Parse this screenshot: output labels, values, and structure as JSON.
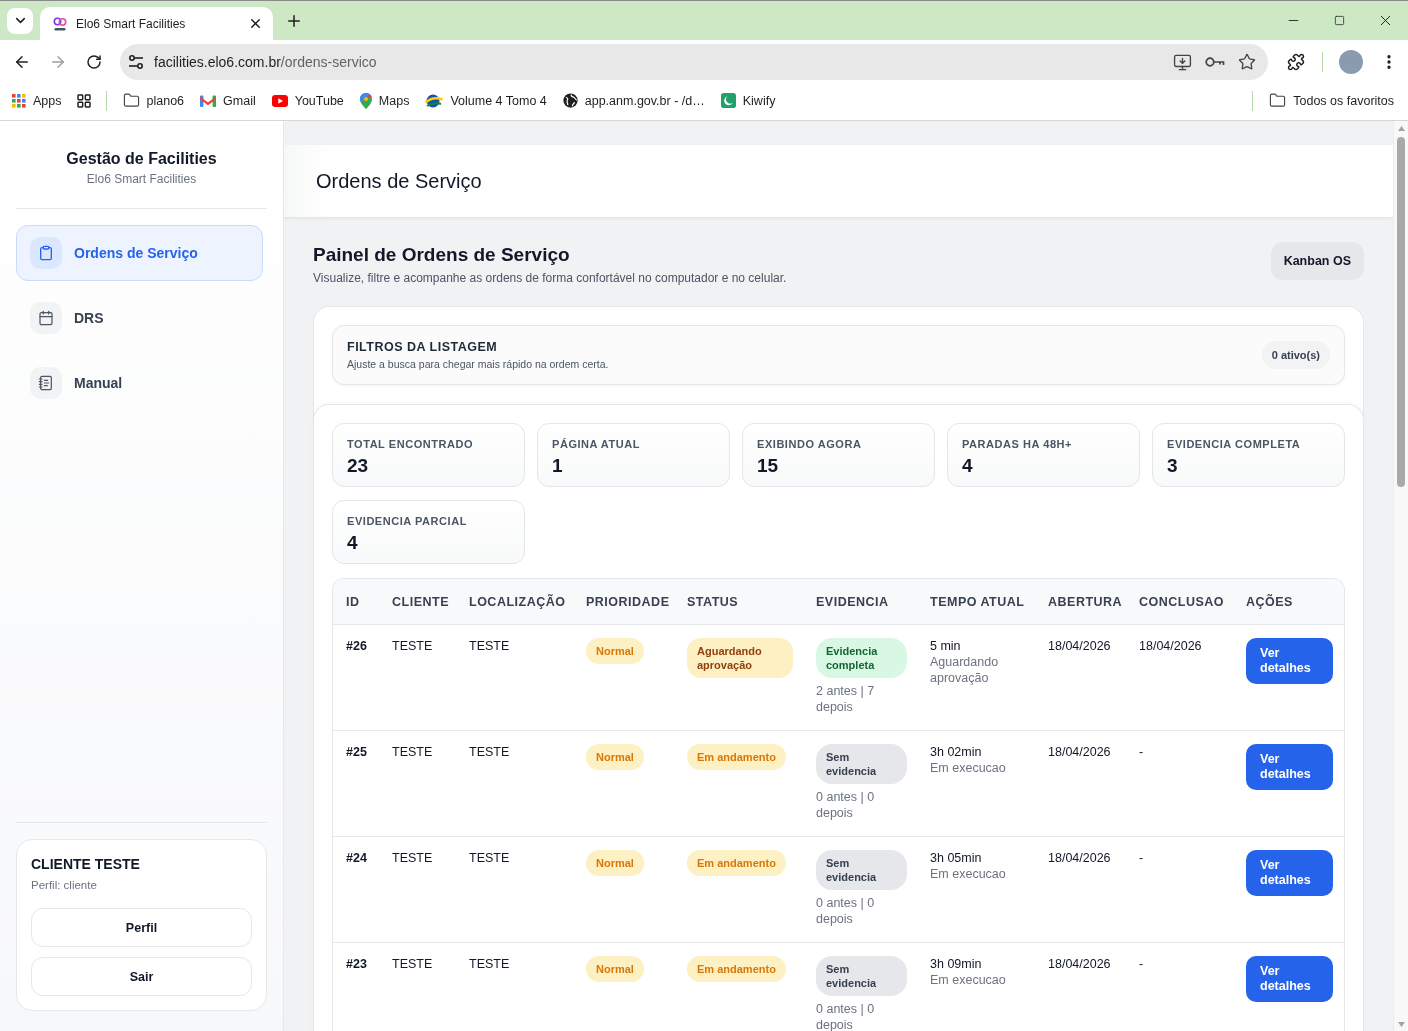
{
  "browser": {
    "tabs": [
      {
        "title": "Elo6 Smart Facilities",
        "selected": true
      }
    ],
    "address": {
      "host": "facilities.elo6.com.br",
      "path": "/ordens-servico"
    },
    "apps": {
      "label": "Apps"
    },
    "bookmarks": [
      {
        "kind": "folder",
        "label": "plano6"
      },
      {
        "kind": "mail",
        "label": "Gmail"
      },
      {
        "kind": "video",
        "label": "YouTube"
      },
      {
        "kind": "map",
        "label": "Maps"
      },
      {
        "kind": "swoosh",
        "label": "Volume 4 Tomo 4"
      },
      {
        "kind": "globe",
        "label": "app.anm.gov.br - /d…"
      },
      {
        "kind": "crescent",
        "label": "Kiwify"
      }
    ],
    "all_bookmarks": "Todos os favoritos"
  },
  "sidebar": {
    "title": "Gestão de Facilities",
    "subtitle": "Elo6 Smart Facilities",
    "nav": [
      {
        "label": "Ordens de Serviço",
        "kind": "orders",
        "selected": true
      },
      {
        "label": "DRS",
        "kind": "calendar",
        "selected": false
      },
      {
        "label": "Manual",
        "kind": "manual",
        "selected": false
      }
    ],
    "user": {
      "name": "CLIENTE TESTE",
      "role": "Perfil: cliente",
      "buttons": [
        "Perfil",
        "Sair"
      ]
    }
  },
  "header": {
    "title": "Ordens de Serviço"
  },
  "panel": {
    "title": "Painel de Ordens de Serviço",
    "subtitle": "Visualize, filtre e acompanhe as ordens de forma confortável no computador e no celular.",
    "button": "Kanban OS"
  },
  "filters": {
    "title": "FILTROS DA LISTAGEM",
    "hint": "Ajuste a busca para chegar mais rápido na ordem certa.",
    "active_count": "0 ativo(s)"
  },
  "stats": [
    {
      "label": "TOTAL ENCONTRADO",
      "value": "23"
    },
    {
      "label": "PÁGINA ATUAL",
      "value": "1"
    },
    {
      "label": "EXIBINDO AGORA",
      "value": "15"
    },
    {
      "label": "PARADAS HA 48H+",
      "value": "4"
    },
    {
      "label": "EVIDENCIA COMPLETA",
      "value": "3"
    },
    {
      "label": "EVIDENCIA PARCIAL",
      "value": "4"
    }
  ],
  "table": {
    "columns": [
      "ID",
      "CLIENTE",
      "LOCALIZAÇÃO",
      "PRIORIDADE",
      "STATUS",
      "EVIDENCIA",
      "TEMPO ATUAL",
      "ABERTURA",
      "CONCLUSAO",
      "AÇÕES"
    ],
    "rows": [
      {
        "id": "#26",
        "client": "TESTE",
        "location": "TESTE",
        "priority": {
          "label": "Normal",
          "kind": "normal"
        },
        "status": {
          "label": "Aguardando aprovação",
          "kind": "awaiting"
        },
        "evidence": {
          "label": "Evidencia completa",
          "kind": "complete"
        },
        "evidence_count": "2 antes | 7 depois",
        "time": "5 min",
        "time_note": "Aguardando aprovação",
        "opened": "18/04/2026",
        "closed": "18/04/2026",
        "action": "Ver detalhes"
      },
      {
        "id": "#25",
        "client": "TESTE",
        "location": "TESTE",
        "priority": {
          "label": "Normal",
          "kind": "normal"
        },
        "status": {
          "label": "Em andamento",
          "kind": "in_progress"
        },
        "evidence": {
          "label": "Sem evidencia",
          "kind": "none"
        },
        "evidence_count": "0 antes | 0 depois",
        "time": "3h 02min",
        "time_note": "Em execucao",
        "opened": "18/04/2026",
        "closed": "-",
        "action": "Ver detalhes"
      },
      {
        "id": "#24",
        "client": "TESTE",
        "location": "TESTE",
        "priority": {
          "label": "Normal",
          "kind": "normal"
        },
        "status": {
          "label": "Em andamento",
          "kind": "in_progress"
        },
        "evidence": {
          "label": "Sem evidencia",
          "kind": "none"
        },
        "evidence_count": "0 antes | 0 depois",
        "time": "3h 05min",
        "time_note": "Em execucao",
        "opened": "18/04/2026",
        "closed": "-",
        "action": "Ver detalhes"
      },
      {
        "id": "#23",
        "client": "TESTE",
        "location": "TESTE",
        "priority": {
          "label": "Normal",
          "kind": "normal"
        },
        "status": {
          "label": "Em andamento",
          "kind": "in_progress"
        },
        "evidence": {
          "label": "Sem evidencia",
          "kind": "none"
        },
        "evidence_count": "0 antes | 0 depois",
        "time": "3h 09min",
        "time_note": "Em execucao",
        "opened": "18/04/2026",
        "closed": "-",
        "action": "Ver detalhes"
      }
    ]
  }
}
